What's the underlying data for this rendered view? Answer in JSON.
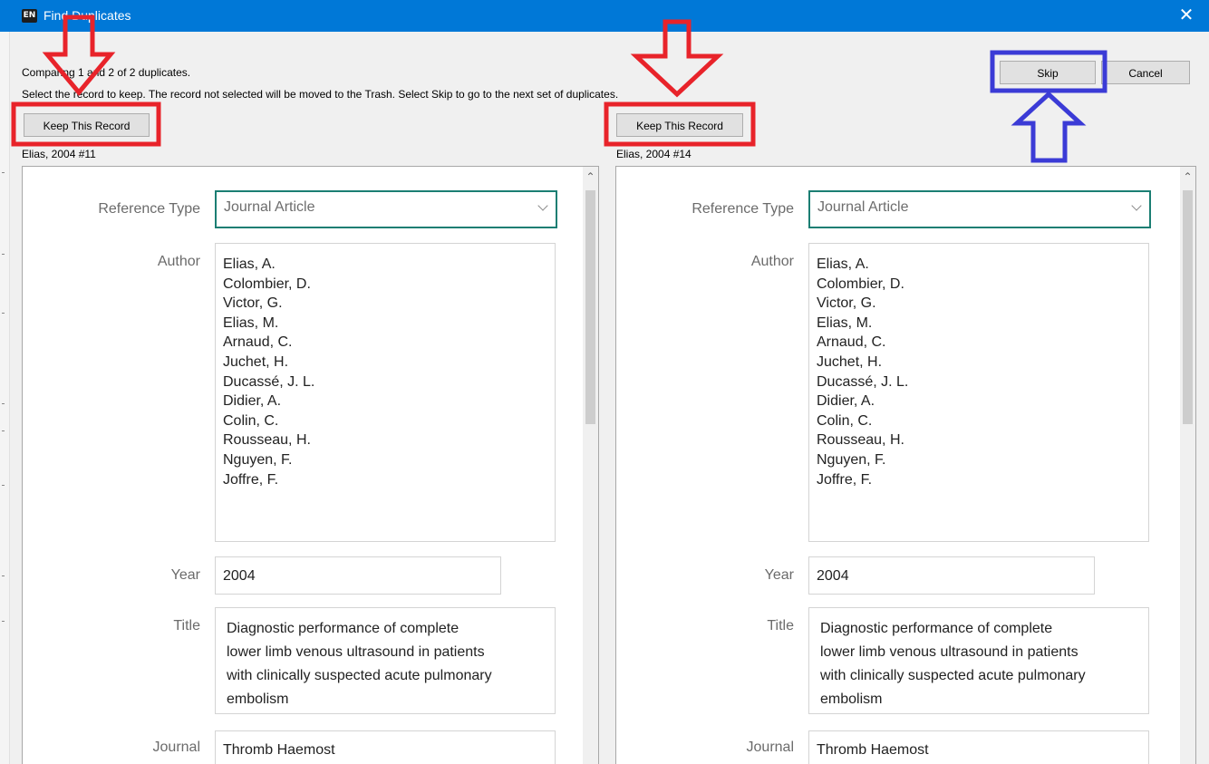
{
  "window": {
    "title": "Find Duplicates",
    "app_icon_text": "EN"
  },
  "info": {
    "comparing": "Comparing 1 and 2 of 2 duplicates.",
    "instructions": "Select the record to keep. The record not selected will be moved to the Trash. Select Skip to go to the next set of duplicates."
  },
  "buttons": {
    "skip": "Skip",
    "cancel": "Cancel",
    "keep": "Keep This Record"
  },
  "records": [
    {
      "header": "Elias, 2004 #11",
      "labels": {
        "reference_type": "Reference Type",
        "author": "Author",
        "year": "Year",
        "title": "Title",
        "journal": "Journal"
      },
      "reference_type": "Journal Article",
      "authors": [
        "Elias, A.",
        "Colombier, D.",
        "Victor, G.",
        "Elias, M.",
        "Arnaud, C.",
        "Juchet, H.",
        "Ducassé, J. L.",
        "Didier, A.",
        "Colin, C.",
        "Rousseau, H.",
        "Nguyen, F.",
        "Joffre, F."
      ],
      "year": "2004",
      "title": "Diagnostic performance of complete lower limb venous ultrasound in patients with clinically suspected acute pulmonary embolism",
      "title_lines": [
        "Diagnostic performance of complete",
        "lower limb venous ultrasound in patients",
        "with clinically suspected acute pulmonary",
        "embolism"
      ],
      "journal": "Thromb Haemost"
    },
    {
      "header": "Elias, 2004 #14",
      "labels": {
        "reference_type": "Reference Type",
        "author": "Author",
        "year": "Year",
        "title": "Title",
        "journal": "Journal"
      },
      "reference_type": "Journal Article",
      "authors": [
        "Elias, A.",
        "Colombier, D.",
        "Victor, G.",
        "Elias, M.",
        "Arnaud, C.",
        "Juchet, H.",
        "Ducassé, J. L.",
        "Didier, A.",
        "Colin, C.",
        "Rousseau, H.",
        "Nguyen, F.",
        "Joffre, F."
      ],
      "year": "2004",
      "title_lines": [
        "Diagnostic performance of complete",
        "lower limb venous ultrasound in patients",
        "with clinically suspected acute pulmonary",
        "embolism"
      ],
      "journal": "Thromb Haemost"
    }
  ],
  "annotation_colors": {
    "red": "#e8232a",
    "blue": "#3b3bd6"
  }
}
